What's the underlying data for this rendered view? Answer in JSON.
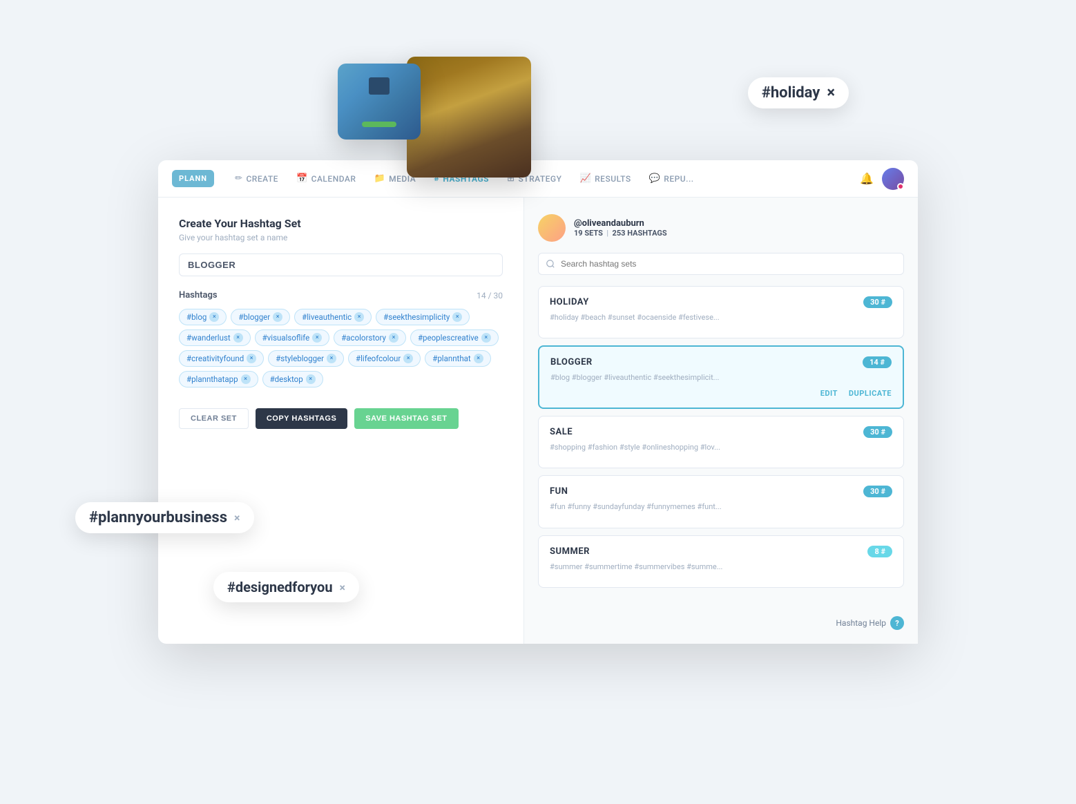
{
  "nav": {
    "logo": "PLANN",
    "items": [
      {
        "id": "create",
        "label": "CREATE",
        "icon": "✏️"
      },
      {
        "id": "calendar",
        "label": "CALENDAR",
        "icon": "📅"
      },
      {
        "id": "media",
        "label": "MEDIA",
        "icon": "📁"
      },
      {
        "id": "hashtags",
        "label": "HASHTAGS",
        "icon": "#",
        "active": true
      },
      {
        "id": "strategy",
        "label": "STRATEGY",
        "icon": "⊞"
      },
      {
        "id": "results",
        "label": "RESULTS",
        "icon": "📈"
      },
      {
        "id": "repu",
        "label": "REPU...",
        "icon": "💬"
      }
    ]
  },
  "left_panel": {
    "title": "Create Your Hashtag Set",
    "subtitle": "Give your hashtag set a name",
    "set_name_placeholder": "BLOGGER",
    "hashtags_label": "Hashtags",
    "hashtags_count": "14 / 30",
    "hashtags": [
      "#blog",
      "#blogger",
      "#liveauthentic",
      "#seekthesimplicity",
      "#wanderlust",
      "#visualsoflife",
      "#acolorstory",
      "#peoplescreative",
      "#creativityfound",
      "#styleblogger",
      "#lifeofcolour",
      "#plannthat",
      "#plannthatapp",
      "#desktop"
    ],
    "buttons": {
      "clear": "CLEAR SET",
      "copy": "COPY HASHTAGS",
      "save": "SAVE HASHTAG SET"
    }
  },
  "right_panel": {
    "profile": {
      "name": "@oliveandauburn",
      "sets_count": "19",
      "sets_label": "SETS",
      "hashtags_count": "253",
      "hashtags_label": "HASHTAGS"
    },
    "search_placeholder": "Search hashtag sets",
    "cards": [
      {
        "id": "holiday",
        "title": "HOLIDAY",
        "badge": "30 #",
        "hashtags": "#holiday #beach #sunset #ocaenside #festivese...",
        "active": false
      },
      {
        "id": "blogger",
        "title": "BLOGGER",
        "badge": "14 #",
        "hashtags": "#blog #blogger #liveauthentic #seekthesimplicit...",
        "active": true,
        "actions": [
          "EDIT",
          "DUPLICATE"
        ]
      },
      {
        "id": "sale",
        "title": "SALE",
        "badge": "30 #",
        "hashtags": "#shopping #fashion #style #onlineshopping #lov...",
        "active": false
      },
      {
        "id": "fun",
        "title": "FUN",
        "badge": "30 #",
        "hashtags": "#fun #funny #sundayfunday #funnymemes #funt...",
        "active": false
      },
      {
        "id": "summer",
        "title": "SUMMER",
        "badge": "8 #",
        "hashtags": "#summer #summertime #summervibes #summe...",
        "active": false
      }
    ],
    "hashtag_help_label": "Hashtag Help"
  },
  "floating_tags": {
    "plannyourbusiness": "#plannyourbusiness",
    "designedforyou": "#designedforyou",
    "holiday": "#holiday"
  }
}
